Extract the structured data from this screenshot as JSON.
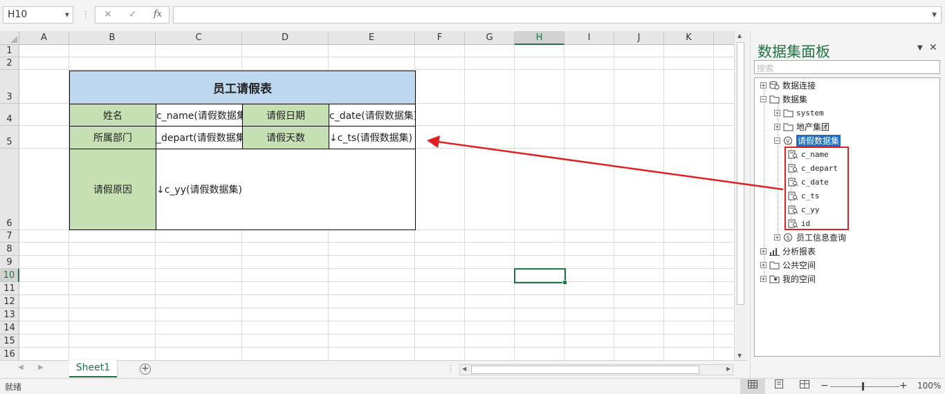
{
  "formula_bar": {
    "name_box": "H10",
    "cancel_icon": "✕",
    "enter_icon": "✓",
    "fx_label": "fx",
    "formula": ""
  },
  "columns": [
    "A",
    "B",
    "C",
    "D",
    "E",
    "F",
    "G",
    "H",
    "I",
    "J",
    "K"
  ],
  "selected_column": "H",
  "rows": [
    "1",
    "2",
    "3",
    "4",
    "5",
    "6",
    "7",
    "8",
    "9",
    "10",
    "11",
    "12",
    "13",
    "14",
    "15",
    "16"
  ],
  "selected_row": "10",
  "report": {
    "title": "员工请假表",
    "name_label": "姓名",
    "name_value": "c_name(请假数据集",
    "date_label": "请假日期",
    "date_value": "c_date(请假数据集)",
    "dept_label": "所属部门",
    "dept_value": "_depart(请假数据集",
    "days_label": "请假天数",
    "days_value": "↓c_ts(请假数据集)",
    "reason_label": "请假原因",
    "reason_value": "↓c_yy(请假数据集)"
  },
  "sheet_tabs": [
    {
      "label": "Sheet1",
      "active": true
    }
  ],
  "status": {
    "ready": "就绪",
    "zoom": "100%"
  },
  "panel": {
    "title": "数据集面板",
    "search_placeholder": "搜索",
    "tree": {
      "connections": "数据连接",
      "datasets": "数据集",
      "system": "system",
      "realestate": "地产集团",
      "leave_dataset": "请假数据集",
      "fields": [
        "c_name",
        "c_depart",
        "c_date",
        "c_ts",
        "c_yy",
        "id"
      ],
      "employee_query": "员工信息查询",
      "analysis_reports": "分析报表",
      "public_space": "公共空间",
      "my_space": "我的空间"
    }
  },
  "accent_color": "#217346",
  "highlight_color": "#e02020"
}
